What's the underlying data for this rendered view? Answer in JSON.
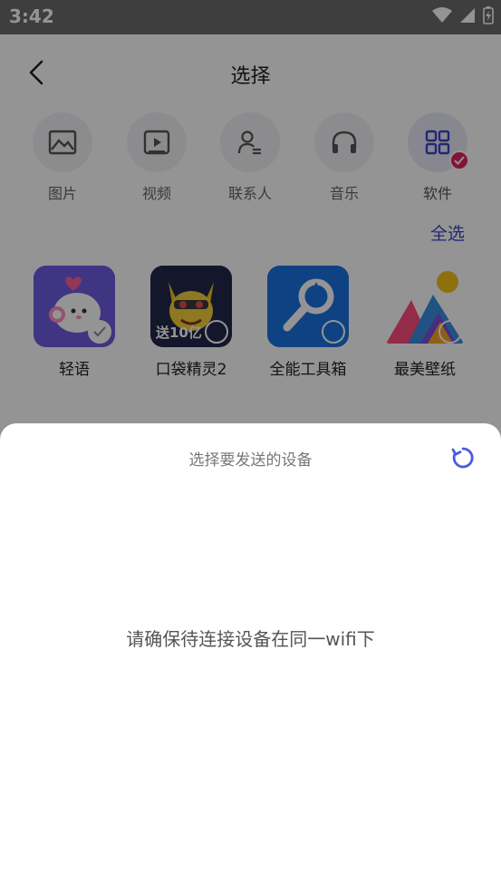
{
  "status_bar": {
    "time": "3:42"
  },
  "header": {
    "title": "选择"
  },
  "categories": [
    {
      "label": "图片",
      "icon": "image-icon"
    },
    {
      "label": "视频",
      "icon": "video-icon"
    },
    {
      "label": "联系人",
      "icon": "contact-icon"
    },
    {
      "label": "音乐",
      "icon": "headphones-icon"
    },
    {
      "label": "软件",
      "icon": "apps-grid-icon",
      "active": true
    }
  ],
  "select_all_label": "全选",
  "apps": [
    {
      "name": "轻语",
      "selected": true
    },
    {
      "name": "口袋精灵2",
      "selected": false,
      "art_text": "送10亿"
    },
    {
      "name": "全能工具箱",
      "selected": false
    },
    {
      "name": "最美壁纸",
      "selected": false
    }
  ],
  "sheet": {
    "title": "选择要发送的设备",
    "message": "请确保待连接设备在同一wifi下"
  },
  "colors": {
    "accent": "#3a45c8",
    "badge": "#e0245e",
    "refresh": "#4a5be0"
  }
}
